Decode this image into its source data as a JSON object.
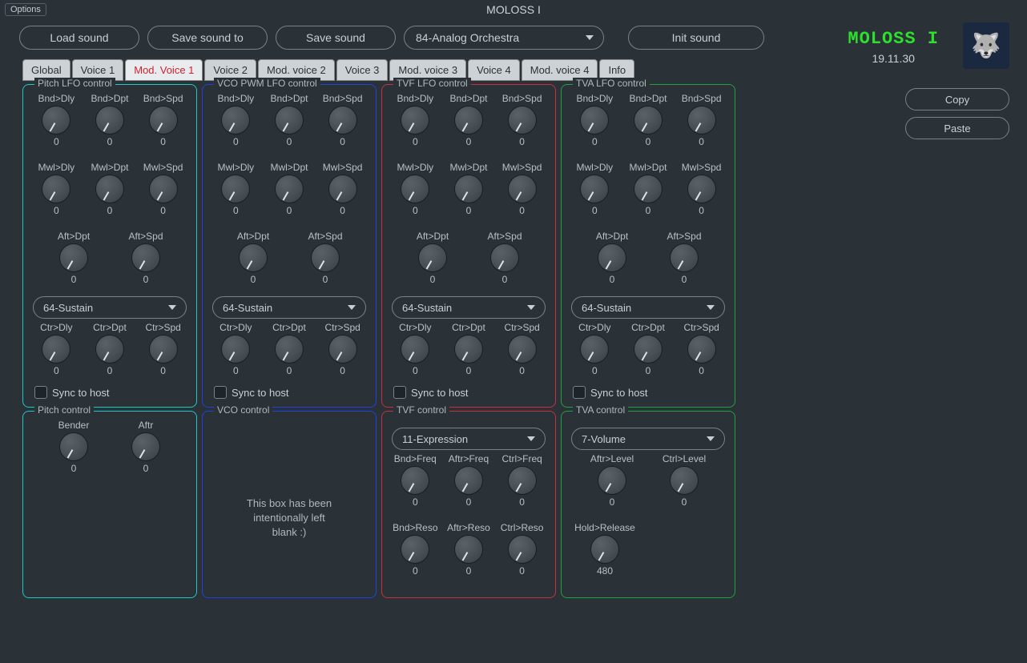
{
  "title": "MOLOSS I",
  "options": "Options",
  "brand": {
    "name": "MOLOSS I",
    "date": "19.11.30"
  },
  "toolbar": {
    "load": "Load sound",
    "saveTo": "Save sound to",
    "save": "Save sound",
    "preset": "84-Analog Orchestra",
    "init": "Init sound"
  },
  "side": {
    "copy": "Copy",
    "paste": "Paste"
  },
  "tabs": [
    "Global",
    "Voice 1",
    "Mod. Voice 1",
    "Voice 2",
    "Mod. voice 2",
    "Voice 3",
    "Mod. voice 3",
    "Voice 4",
    "Mod. voice 4",
    "Info"
  ],
  "activeTab": 2,
  "sustainOption": "64-Sustain",
  "syncLabel": "Sync to host",
  "knobLabels": {
    "bndDly": "Bnd>Dly",
    "bndDpt": "Bnd>Dpt",
    "bndSpd": "Bnd>Spd",
    "mwlDly": "Mwl>Dly",
    "mwlDpt": "Mwl>Dpt",
    "mwlSpd": "Mwl>Spd",
    "aftDpt": "Aft>Dpt",
    "aftSpd": "Aft>Spd",
    "ctrDly": "Ctr>Dly",
    "ctrDpt": "Ctr>Dpt",
    "ctrSpd": "Ctr>Spd",
    "bender": "Bender",
    "aftr": "Aftr",
    "bndFreq": "Bnd>Freq",
    "aftrFreq": "Aftr>Freq",
    "ctrlFreq": "Ctrl>Freq",
    "bndReso": "Bnd>Reso",
    "aftrReso": "Aftr>Reso",
    "ctrlReso": "Ctrl>Reso",
    "aftrLevel": "Aftr>Level",
    "ctrlLevel": "Ctrl>Level",
    "holdRelease": "Hold>Release"
  },
  "panels": {
    "pitchLfo": {
      "title": "Pitch LFO control",
      "vals": {
        "bndDly": "0",
        "bndDpt": "0",
        "bndSpd": "0",
        "mwlDly": "0",
        "mwlDpt": "0",
        "mwlSpd": "0",
        "aftDpt": "0",
        "aftSpd": "0",
        "ctrDly": "0",
        "ctrDpt": "0",
        "ctrSpd": "0"
      }
    },
    "vcoLfo": {
      "title": "VCO PWM LFO control",
      "vals": {
        "bndDly": "0",
        "bndDpt": "0",
        "bndSpd": "0",
        "mwlDly": "0",
        "mwlDpt": "0",
        "mwlSpd": "0",
        "aftDpt": "0",
        "aftSpd": "0",
        "ctrDly": "0",
        "ctrDpt": "0",
        "ctrSpd": "0"
      }
    },
    "tvfLfo": {
      "title": "TVF LFO control",
      "vals": {
        "bndDly": "0",
        "bndDpt": "0",
        "bndSpd": "0",
        "mwlDly": "0",
        "mwlDpt": "0",
        "mwlSpd": "0",
        "aftDpt": "0",
        "aftSpd": "0",
        "ctrDly": "0",
        "ctrDpt": "0",
        "ctrSpd": "0"
      }
    },
    "tvaLfo": {
      "title": "TVA LFO control",
      "vals": {
        "bndDly": "0",
        "bndDpt": "0",
        "bndSpd": "0",
        "mwlDly": "0",
        "mwlDpt": "0",
        "mwlSpd": "0",
        "aftDpt": "0",
        "aftSpd": "0",
        "ctrDly": "0",
        "ctrDpt": "0",
        "ctrSpd": "0"
      }
    },
    "pitchCtrl": {
      "title": "Pitch control",
      "vals": {
        "bender": "0",
        "aftr": "0"
      }
    },
    "vcoCtrl": {
      "title": "VCO control",
      "blank": "This box has been intentionally left blank :)"
    },
    "tvfCtrl": {
      "title": "TVF control",
      "select": "11-Expression",
      "vals": {
        "bndFreq": "0",
        "aftrFreq": "0",
        "ctrlFreq": "0",
        "bndReso": "0",
        "aftrReso": "0",
        "ctrlReso": "0"
      }
    },
    "tvaCtrl": {
      "title": "TVA control",
      "select": "7-Volume",
      "vals": {
        "aftrLevel": "0",
        "ctrlLevel": "0",
        "holdRelease": "480"
      }
    }
  }
}
